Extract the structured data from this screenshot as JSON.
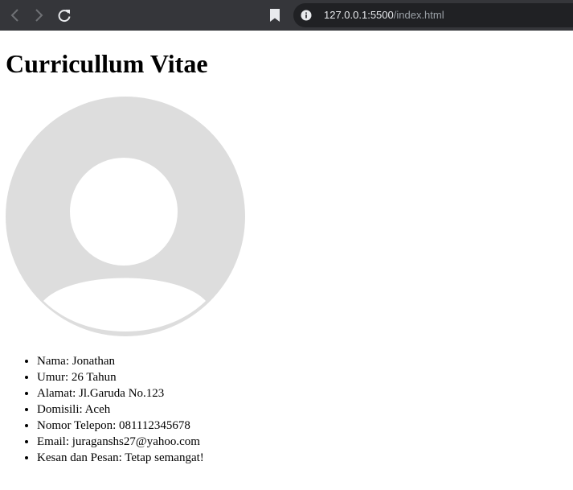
{
  "browser": {
    "url_host": "127.0.0.1:5500",
    "url_path": "/index.html"
  },
  "page": {
    "title": "Curricullum Vitae",
    "details": [
      "Nama: Jonathan",
      "Umur: 26 Tahun",
      "Alamat: Jl.Garuda No.123",
      "Domisili: Aceh",
      "Nomor Telepon: 081112345678",
      "Email: juraganshs27@yahoo.com",
      "Kesan dan Pesan: Tetap semangat!"
    ]
  },
  "colors": {
    "toolbar": "#35363a",
    "omnibox": "#202124",
    "avatar_gray": "#dddddd"
  },
  "icons": {
    "back": "arrow-left-icon",
    "forward": "arrow-right-icon",
    "reload": "reload-icon",
    "bookmark": "bookmark-icon",
    "info": "info-icon",
    "avatar": "default-user-avatar"
  }
}
